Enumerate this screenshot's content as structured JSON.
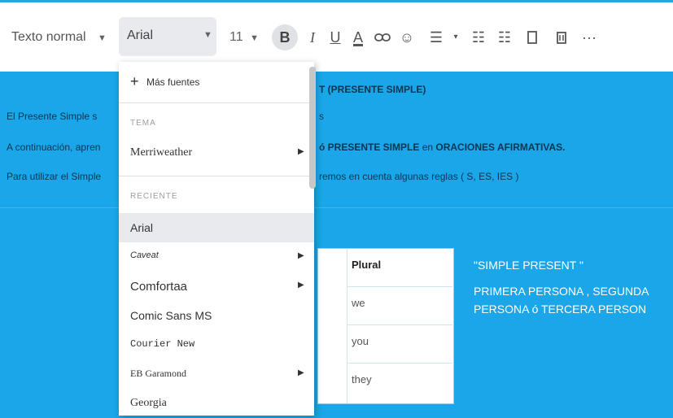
{
  "toolbar": {
    "style_label": "Texto normal",
    "font_label": "Arial",
    "size_label": "11",
    "bold": "B",
    "italic": "I",
    "underline": "U",
    "text_color": "A",
    "more": "···"
  },
  "document": {
    "heading_tail": "T  (PRESENTE SIMPLE)",
    "line1_left": "El Presente Simple s",
    "line1_right": "s",
    "line2_left": "A continuación, apren",
    "line2_right_a": "ó PRESENTE SIMPLE",
    "line2_right_b": " en ",
    "line2_right_c": "ORACIONES AFIRMATIVAS.",
    "line3_left": "Para utilizar el Simple",
    "line3_right": "remos en cuenta algunas reglas ( S, ES, IES )"
  },
  "table": {
    "header": "Plural",
    "rows": [
      "we",
      "you",
      "they"
    ]
  },
  "side_note": {
    "title": "\"SIMPLE PRESENT \"",
    "line1": "PRIMERA PERSONA , SEGUNDA",
    "line2": "PERSONA ó TERCERA PERSON"
  },
  "font_menu": {
    "more_fonts": "Más fuentes",
    "section_theme": "TEMA",
    "theme_font": "Merriweather",
    "section_recent": "RECIENTE",
    "fonts": [
      "Arial",
      "Caveat",
      "Comfortaa",
      "Comic Sans MS",
      "Courier New",
      "EB Garamond",
      "Georgia"
    ]
  }
}
